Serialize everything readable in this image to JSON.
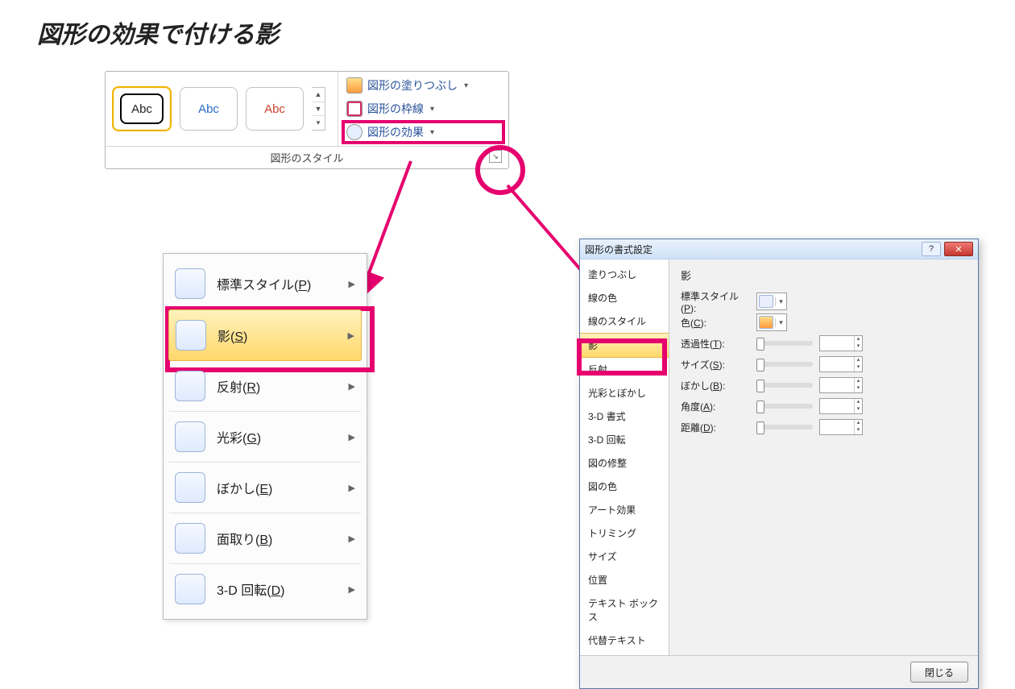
{
  "page_title": "図形の効果で付ける影",
  "ribbon": {
    "sample_text": "Abc",
    "cmd_fill": "図形の塗りつぶし",
    "cmd_outline": "図形の枠線",
    "cmd_effect": "図形の効果",
    "group_caption": "図形のスタイル"
  },
  "menu": {
    "items": [
      {
        "label_pre": "標準スタイル(",
        "accel": "P",
        "label_post": ")"
      },
      {
        "label_pre": "影(",
        "accel": "S",
        "label_post": ")"
      },
      {
        "label_pre": "反射(",
        "accel": "R",
        "label_post": ")"
      },
      {
        "label_pre": "光彩(",
        "accel": "G",
        "label_post": ")"
      },
      {
        "label_pre": "ぼかし(",
        "accel": "E",
        "label_post": ")"
      },
      {
        "label_pre": "面取り(",
        "accel": "B",
        "label_post": ")"
      },
      {
        "label_pre": "3-D 回転(",
        "accel": "D",
        "label_post": ")"
      }
    ]
  },
  "dialog": {
    "title": "図形の書式設定",
    "close_btn": "閉じる",
    "categories": [
      "塗りつぶし",
      "線の色",
      "線のスタイル",
      "影",
      "反射",
      "光彩とぼかし",
      "3-D 書式",
      "3-D 回転",
      "図の修整",
      "図の色",
      "アート効果",
      "トリミング",
      "サイズ",
      "位置",
      "テキスト ボックス",
      "代替テキスト"
    ],
    "pane": {
      "heading": "影",
      "preset_pre": "標準スタイル(",
      "preset_acc": "P",
      "preset_post": "):",
      "color_pre": "色(",
      "color_acc": "C",
      "color_post": "):",
      "trans_pre": "透過性(",
      "trans_acc": "T",
      "trans_post": "):",
      "size_pre": "サイズ(",
      "size_acc": "S",
      "size_post": "):",
      "blur_pre": "ぼかし(",
      "blur_acc": "B",
      "blur_post": "):",
      "angle_pre": "角度(",
      "angle_acc": "A",
      "angle_post": "):",
      "dist_pre": "距離(",
      "dist_acc": "D",
      "dist_post": "):"
    }
  }
}
